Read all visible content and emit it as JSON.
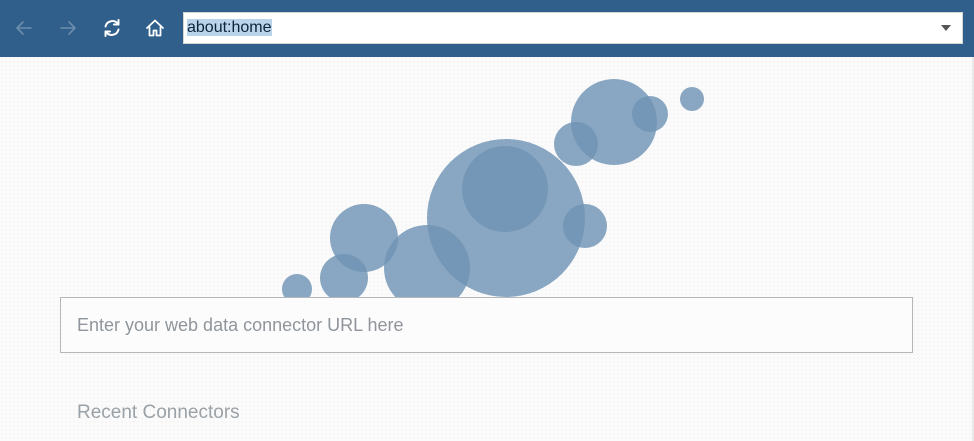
{
  "toolbar": {
    "back_icon": "arrow-left-icon",
    "forward_icon": "arrow-right-icon",
    "reload_icon": "reload-icon",
    "home_icon": "home-icon",
    "background_color": "#2f5f8a",
    "disabled_icon_color": "#6c8eae",
    "active_icon_color": "#ffffff"
  },
  "address_bar": {
    "value": "about:home",
    "value_selected": true,
    "dropdown_icon": "caret-down-icon"
  },
  "main": {
    "decoration": "bubbles-illustration",
    "bubble_color": "#6f94b5",
    "connector_input": {
      "value": "",
      "placeholder": "Enter your web data connector URL here"
    },
    "recent_connectors_heading": "Recent Connectors"
  }
}
